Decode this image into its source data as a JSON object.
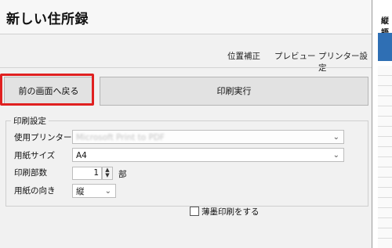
{
  "window": {
    "title": "新しい住所録"
  },
  "menu": {
    "align": "位置補正",
    "preview": "プレビュー",
    "printer_settings": "プリンター設定"
  },
  "buttons": {
    "back": "前の画面へ戻る",
    "print": "印刷実行"
  },
  "print_settings": {
    "group_title": "印刷設定",
    "printer_label": "使用プリンター",
    "printer_value": "Microsoft Print to PDF",
    "paper_label": "用紙サイズ",
    "paper_value": "A4",
    "copies_label": "印刷部数",
    "copies_value": "1",
    "copies_unit": "部",
    "orientation_label": "用紙の向き",
    "orientation_value": "縦",
    "light_print_label": "薄墨印刷をする",
    "light_print_checked": false
  },
  "right_pane": {
    "title": "縦語"
  },
  "colors": {
    "highlight": "#e02020",
    "accent_bar": "#2f6fb4"
  }
}
